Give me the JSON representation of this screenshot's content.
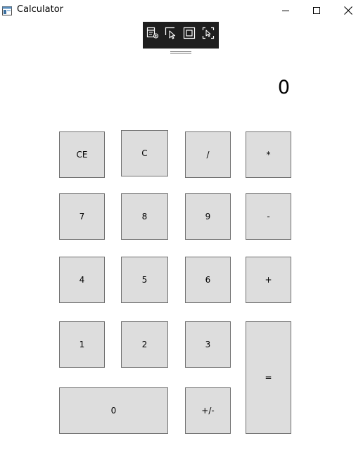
{
  "window": {
    "title": "Calculator",
    "icon": "calculator-app-icon",
    "controls": [
      "minimize-icon",
      "maximize-icon",
      "close-icon"
    ]
  },
  "debug_toolbar": {
    "tools": [
      "live-visual-tree-icon",
      "select-element-icon",
      "display-layout-adorners-icon",
      "track-focused-element-icon"
    ]
  },
  "display": {
    "value": "0"
  },
  "keys": {
    "ce": "CE",
    "c": "C",
    "divide": "/",
    "multiply": "*",
    "seven": "7",
    "eight": "8",
    "nine": "9",
    "minus": "-",
    "four": "4",
    "five": "5",
    "six": "6",
    "plus": "+",
    "one": "1",
    "two": "2",
    "three": "3",
    "equals": "=",
    "zero": "0",
    "negate": "+/-"
  }
}
